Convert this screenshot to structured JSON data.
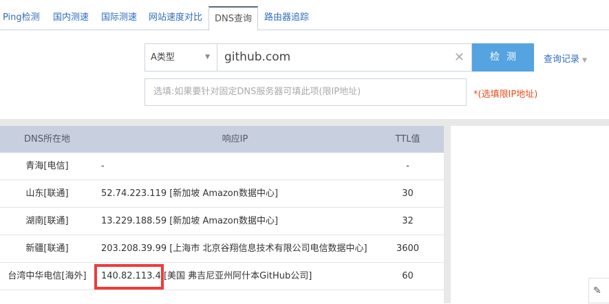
{
  "tabs": [
    {
      "label": "Ping检测"
    },
    {
      "label": "国内测速"
    },
    {
      "label": "国际测速"
    },
    {
      "label": "网站速度对比"
    },
    {
      "label": "DNS查询",
      "active": true
    },
    {
      "label": "路由器追踪"
    }
  ],
  "query": {
    "type_select": "A类型",
    "domain_value": "github.com",
    "check_button": "检测",
    "history_link": "查询记录",
    "dns_server_placeholder": "选填:如果要针对固定DNS服务器可填此项(限IP地址)",
    "dns_server_note": "*(选填限IP地址)"
  },
  "table": {
    "headers": [
      "DNS所在地",
      "响应IP",
      "TTL值"
    ],
    "rows": [
      {
        "location": "青海[电信]",
        "ip": "-",
        "ttl": "-"
      },
      {
        "location": "山东[联通]",
        "ip": "52.74.223.119 [新加坡 Amazon数据中心]",
        "ttl": "30"
      },
      {
        "location": "湖南[联通]",
        "ip": "13.229.188.59 [新加坡 Amazon数据中心]",
        "ttl": "32"
      },
      {
        "location": "新疆[联通]",
        "ip": "203.208.39.99 [上海市 北京谷翔信息技术有限公司电信数据中心]",
        "ttl": "3600"
      },
      {
        "location": "台湾中华电信[海外]",
        "ip": "140.82.113.4 [美国 弗吉尼亚州阿什本GitHub公司]",
        "ttl": "60"
      }
    ]
  },
  "colors": {
    "accent": "#55a3e0",
    "link": "#2f6cbf",
    "highlight": "#f03a3a",
    "header_bg": "#c8d0e0"
  }
}
